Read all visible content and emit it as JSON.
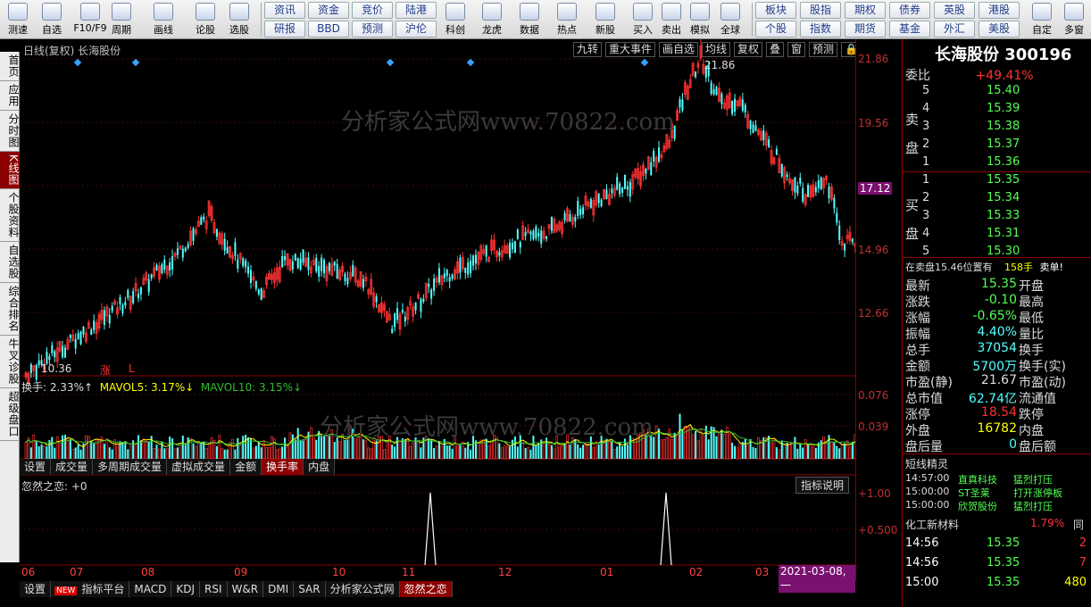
{
  "toolbar": {
    "items": [
      "测速",
      "自选",
      "F10/F9",
      "周期",
      "画线",
      "论股",
      "选股"
    ],
    "icons": [
      "speed-icon",
      "star-icon",
      "f10-icon",
      "cycle-icon",
      "pen-icon",
      "chat-icon",
      "screen-icon"
    ],
    "small1": [
      "资讯",
      "资金",
      "竞价",
      "陆港",
      "研报",
      "BBD",
      "预测",
      "沪伦"
    ],
    "items2": [
      "科创",
      "龙虎",
      "数据",
      "热点",
      "新股",
      "买入",
      "卖出",
      "模拟",
      "全球"
    ],
    "items2_icons": [
      "kc-icon",
      "dragon-icon",
      "pe-icon",
      "hot-icon",
      "ipo-icon",
      "buy-icon",
      "sell-icon",
      "hammer-icon",
      "globe-icon"
    ],
    "small2": [
      "板块",
      "股指",
      "期权",
      "债券",
      "英股",
      "港股",
      "个股",
      "指数",
      "期货",
      "基金",
      "外汇",
      "美股"
    ],
    "items3": [
      "自定",
      "多窗"
    ]
  },
  "leftbar": [
    "首页",
    "应用",
    "分时图",
    "K线图",
    "个股资料",
    "自选股",
    "综合排名",
    "牛叉诊股",
    "超级盘口"
  ],
  "chart": {
    "title": "日线(复权)  长海股份",
    "tools": [
      "九转",
      "重大事件",
      "画自选",
      "均线",
      "复权",
      "叠",
      "窗",
      "预测"
    ],
    "watermark": "分析家公式网www.70822.com",
    "high_label": "21.86",
    "low_label": "10.36",
    "mark_up": "涨",
    "mark_l": "L",
    "vol_legend": {
      "a": "换手: 2.33%↑",
      "b": "MAVOL5: 3.17%↓",
      "c": "MAVOL10: 3.15%↓"
    },
    "vol_tabs": [
      "设置",
      "成交量",
      "多周期成交量",
      "虚拟成交量",
      "金额",
      "换手率",
      "内盘"
    ],
    "ind_label": "忽然之恋: +0",
    "ind_btn": "指标说明",
    "months": [
      "06",
      "07",
      "08",
      "09",
      "10",
      "11",
      "12",
      "01",
      "02",
      "03"
    ],
    "date_box": "2021-03-08,一",
    "bottom_tabs": [
      "设置",
      "指标平台",
      "MACD",
      "KDJ",
      "RSI",
      "W&R",
      "DMI",
      "SAR",
      "分析家公式网",
      "忽然之恋"
    ],
    "new_badge": "NEW"
  },
  "axis": {
    "price": [
      "21.86",
      "19.56",
      "17.12",
      "14.96",
      "12.66"
    ],
    "vol": [
      "0.076",
      "0.039"
    ],
    "ind": [
      "+1.00",
      "+0.500"
    ]
  },
  "quote": {
    "name": "长海股份",
    "code": "300196",
    "webi_label": "委比",
    "webi": "+49.41%",
    "sell_label": "卖盘",
    "buy_label": "买盘",
    "sell": [
      [
        "5",
        "15.40"
      ],
      [
        "4",
        "15.39"
      ],
      [
        "3",
        "15.38"
      ],
      [
        "2",
        "15.37"
      ],
      [
        "1",
        "15.36"
      ]
    ],
    "buy": [
      [
        "1",
        "15.35"
      ],
      [
        "2",
        "15.34"
      ],
      [
        "3",
        "15.33"
      ],
      [
        "4",
        "15.31"
      ],
      [
        "5",
        "15.30"
      ]
    ],
    "note": "在卖盘15.46位置有",
    "note_n": "158手",
    "note_t": "卖单!",
    "stats": [
      [
        "最新",
        "15.35",
        "开盘"
      ],
      [
        "涨跌",
        "-0.10",
        "最高"
      ],
      [
        "涨幅",
        "-0.65%",
        "最低"
      ],
      [
        "振幅",
        "4.40%",
        "量比"
      ],
      [
        "总手",
        "37054",
        "换手"
      ],
      [
        "金额",
        "5700万",
        "换手(实)"
      ],
      [
        "市盈(静)",
        "21.67",
        "市盈(动)"
      ],
      [
        "总市值",
        "62.74亿",
        "流通值"
      ],
      [
        "涨停",
        "18.54",
        "跌停"
      ],
      [
        "外盘",
        "16782",
        "内盘"
      ],
      [
        "盘后量",
        "0",
        "盘后额"
      ]
    ],
    "sprite_title": "短线精灵",
    "sprites": [
      [
        "14:57:00",
        "直真科技",
        "猛烈打压"
      ],
      [
        "15:00:00",
        "ST圣莱",
        "打开涨停板"
      ],
      [
        "15:00:00",
        "欣贺股份",
        "猛烈打压"
      ]
    ],
    "sector": "化工新材料",
    "sector_pct": "1.79%",
    "sector_extra": "同",
    "ticks": [
      [
        "14:56",
        "15.35",
        "2"
      ],
      [
        "14:56",
        "15.35",
        "7"
      ],
      [
        "15:00",
        "15.35",
        "480"
      ]
    ]
  },
  "colors": {
    "up": "#ff3232",
    "down": "#54ffff",
    "yellow": "#ffff00",
    "ma10": "#2fbf2f",
    "accent": "#8b0000"
  }
}
